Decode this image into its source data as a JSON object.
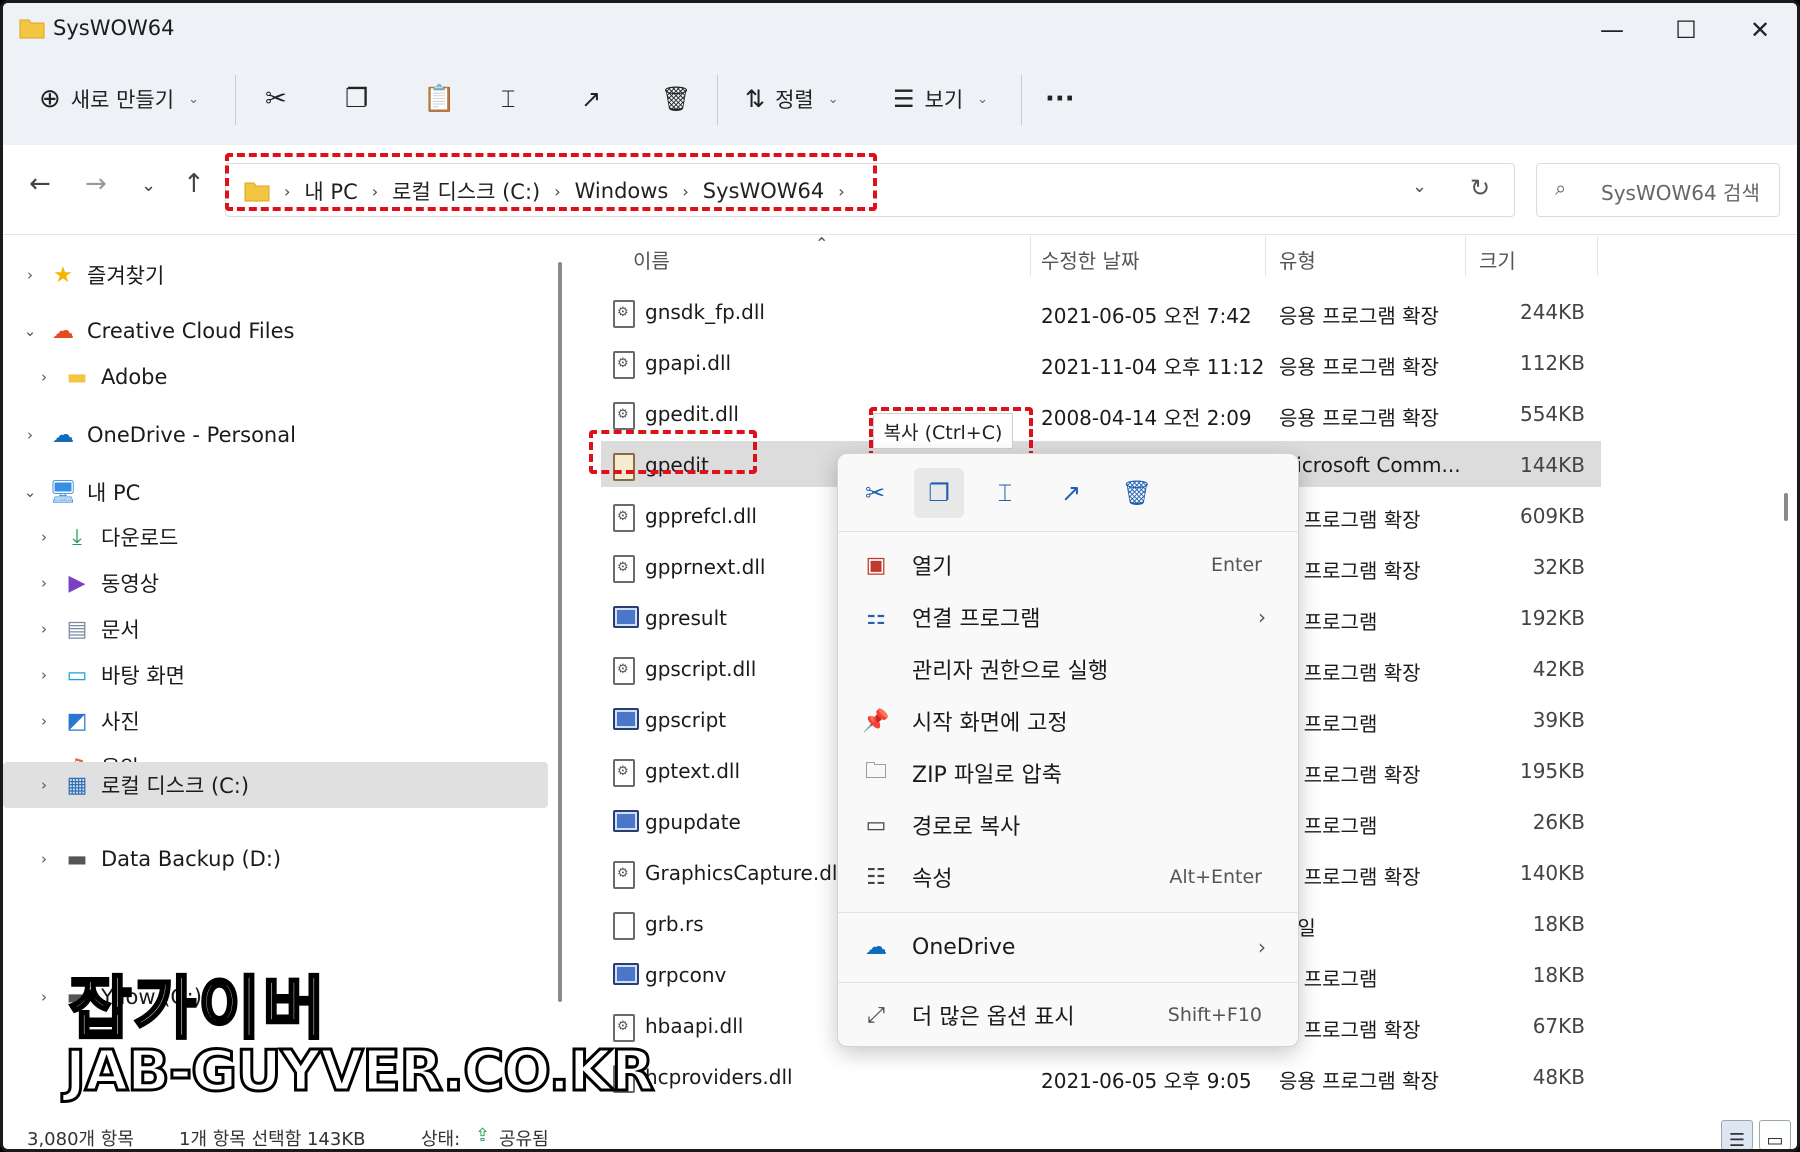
{
  "window": {
    "title": "SysWOW64",
    "minimize": "—",
    "maximize": "☐",
    "close": "✕"
  },
  "toolbar": {
    "new_label": "새로 만들기",
    "sort_label": "정렬",
    "view_label": "보기",
    "more_label": "···"
  },
  "address": {
    "crumbs": [
      "내 PC",
      "로컬 디스크 (C:)",
      "Windows",
      "SysWOW64"
    ],
    "search_placeholder": "SysWOW64 검색"
  },
  "nav": {
    "items": [
      {
        "label": "즐겨찾기",
        "icon": "star-icon"
      },
      {
        "label": "Creative Cloud Files",
        "icon": "creative-cloud-icon"
      },
      {
        "label": "Adobe",
        "icon": "folder-icon"
      },
      {
        "label": "OneDrive - Personal",
        "icon": "cloud-icon"
      },
      {
        "label": "내 PC",
        "icon": "pc-icon"
      },
      {
        "label": "다운로드",
        "icon": "download-icon"
      },
      {
        "label": "동영상",
        "icon": "video-icon"
      },
      {
        "label": "문서",
        "icon": "document-icon"
      },
      {
        "label": "바탕 화면",
        "icon": "desktop-icon"
      },
      {
        "label": "사진",
        "icon": "picture-icon"
      },
      {
        "label": "음악",
        "icon": "music-icon"
      },
      {
        "label": "로컬 디스크 (C:)",
        "icon": "disk-icon"
      },
      {
        "label": "Data Backup (D:)",
        "icon": "drive-icon"
      },
      {
        "label": "Yllow (G:)",
        "icon": "drive-icon"
      }
    ]
  },
  "columns": {
    "name": "이름",
    "date": "수정한 날짜",
    "type": "유형",
    "size": "크기"
  },
  "files": [
    {
      "name": "gnsdk_fp.dll",
      "date": "2021-06-05 오전 7:42",
      "type": "응용 프로그램 확장",
      "size": "244KB"
    },
    {
      "name": "gpapi.dll",
      "date": "2021-11-04 오후 11:12",
      "type": "응용 프로그램 확장",
      "size": "112KB"
    },
    {
      "name": "gpedit.dll",
      "date": "2008-04-14 오전 2:09",
      "type": "응용 프로그램 확장",
      "size": "554KB"
    },
    {
      "name": "gpedit",
      "date": "",
      "type": "Microsoft Comm...",
      "size": "144KB"
    },
    {
      "name": "gpprefcl.dll",
      "date": "",
      "type": "용 프로그램 확장",
      "size": "609KB"
    },
    {
      "name": "gpprnext.dll",
      "date": "",
      "type": "용 프로그램 확장",
      "size": "32KB"
    },
    {
      "name": "gpresult",
      "date": "",
      "type": "용 프로그램",
      "size": "192KB"
    },
    {
      "name": "gpscript.dll",
      "date": "",
      "type": "용 프로그램 확장",
      "size": "42KB"
    },
    {
      "name": "gpscript",
      "date": "",
      "type": "용 프로그램",
      "size": "39KB"
    },
    {
      "name": "gptext.dll",
      "date": "",
      "type": "용 프로그램 확장",
      "size": "195KB"
    },
    {
      "name": "gpupdate",
      "date": "",
      "type": "용 프로그램",
      "size": "26KB"
    },
    {
      "name": "GraphicsCapture.dll",
      "date": "",
      "type": "용 프로그램 확장",
      "size": "140KB"
    },
    {
      "name": "grb.rs",
      "date": "",
      "type": "파일",
      "size": "18KB"
    },
    {
      "name": "grpconv",
      "date": "",
      "type": "용 프로그램",
      "size": "18KB"
    },
    {
      "name": "hbaapi.dll",
      "date": "",
      "type": "용 프로그램 확장",
      "size": "67KB"
    },
    {
      "name": "hcproviders.dll",
      "date": "2021-06-05 오후 9:05",
      "type": "응용 프로그램 확장",
      "size": "48KB"
    }
  ],
  "context_menu": {
    "tooltip": "복사 (Ctrl+C)",
    "items": [
      {
        "label": "열기",
        "shortcut": "Enter"
      },
      {
        "label": "연결 프로그램",
        "shortcut": ""
      },
      {
        "label": "관리자 권한으로 실행",
        "shortcut": ""
      },
      {
        "label": "시작 화면에 고정",
        "shortcut": ""
      },
      {
        "label": "ZIP 파일로 압축",
        "shortcut": ""
      },
      {
        "label": "경로로 복사",
        "shortcut": ""
      },
      {
        "label": "속성",
        "shortcut": "Alt+Enter"
      },
      {
        "label": "OneDrive",
        "shortcut": ""
      },
      {
        "label": "더 많은 옵션 표시",
        "shortcut": "Shift+F10"
      }
    ]
  },
  "status": {
    "count": "3,080개 항목",
    "selected": "1개 항목 선택함 143KB",
    "state_label": "상태:",
    "state_value": "공유됨"
  },
  "watermark": {
    "line1": "잡가이버",
    "line2": "JAB-GUYVER.CO.KR"
  },
  "colors": {
    "accent": "#0067c0",
    "highlight": "#e0101a",
    "folder": "#f4c542"
  }
}
